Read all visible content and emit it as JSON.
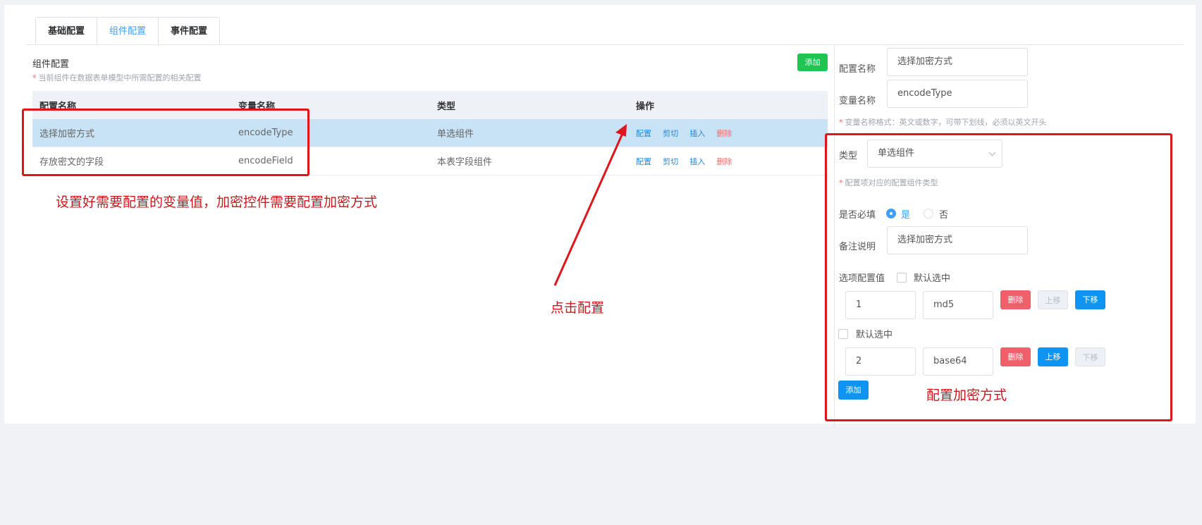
{
  "tabs": [
    {
      "label": "基础配置",
      "active": false
    },
    {
      "label": "组件配置",
      "active": true
    },
    {
      "label": "事件配置",
      "active": false
    }
  ],
  "section": {
    "title": "组件配置",
    "hint": "当前组件在数据表单模型中所需配置的相关配置",
    "add_label": "添加"
  },
  "table": {
    "headers": [
      "配置名称",
      "变量名称",
      "类型",
      "操作"
    ],
    "rows": [
      {
        "name": "选择加密方式",
        "var": "encodeType",
        "type": "单选组件",
        "selected": true
      },
      {
        "name": "存放密文的字段",
        "var": "encodeField",
        "type": "本表字段组件",
        "selected": false
      }
    ],
    "actions": {
      "config": "配置",
      "cut": "剪切",
      "insert": "插入",
      "delete": "删除"
    }
  },
  "form": {
    "config_name_label": "配置名称",
    "config_name_value": "选择加密方式",
    "var_name_label": "变量名称",
    "var_name_value": "encodeType",
    "var_name_hint": "变量名称格式：英文或数字，可带下划线，必须以英文开头",
    "type_label": "类型",
    "type_value": "单选组件",
    "type_hint": "配置项对应的配置组件类型",
    "required_label": "是否必填",
    "required_yes": "是",
    "required_no": "否",
    "remark_label": "备注说明",
    "remark_value": "选择加密方式",
    "options_label": "选项配置值",
    "default_checked_label": "默认选中",
    "options": [
      {
        "key": "1",
        "value": "md5"
      },
      {
        "key": "2",
        "value": "base64"
      }
    ],
    "btn_delete": "删除",
    "btn_up": "上移",
    "btn_down": "下移",
    "btn_add": "添加"
  },
  "annotations": {
    "note1": "设置好需要配置的变量值，加密控件需要配置加密方式",
    "note2": "点击配置",
    "note3": "配置加密方式"
  },
  "colors": {
    "accent": "#409eff",
    "annotation": "#e0141b",
    "add_green": "#1fc452"
  }
}
